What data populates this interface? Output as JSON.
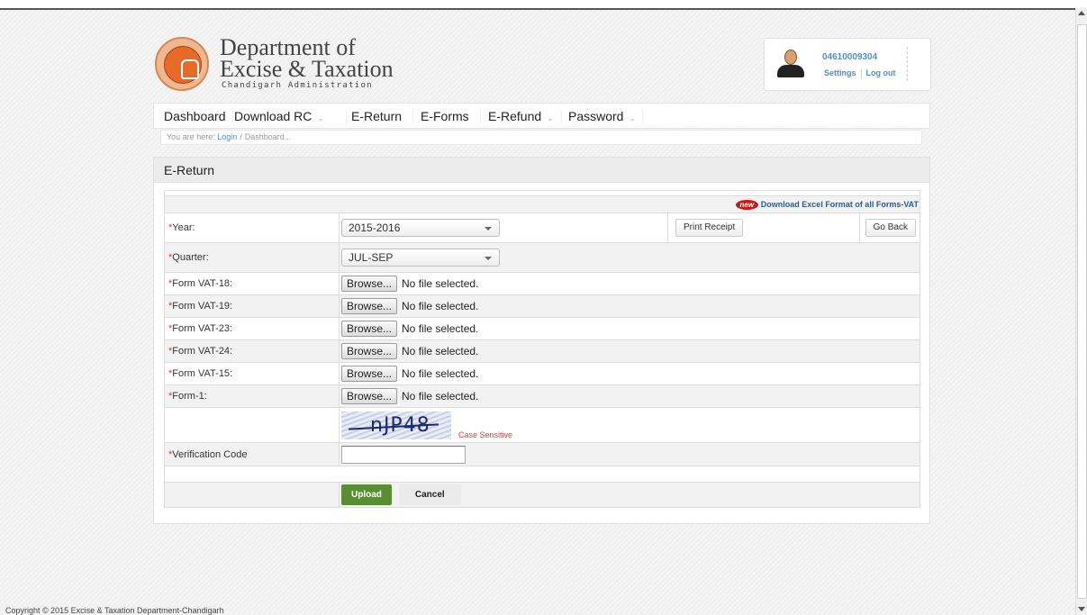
{
  "header": {
    "title_line1": "Department of",
    "title_line2": "Excise & Taxation",
    "subtitle": "Chandigarh Administration"
  },
  "user": {
    "id": "04610009304",
    "settings_label": "Settings",
    "logout_label": "Log out"
  },
  "nav": {
    "dashboard": "Dashboard",
    "download_rc": "Download RC",
    "e_return": "E-Return",
    "e_forms": "E-Forms",
    "e_refund": "E-Refund",
    "password": "Password"
  },
  "breadcrumb": {
    "prefix": "You are here:",
    "login": "Login",
    "separator": "/",
    "current": "Dashboard..."
  },
  "panel": {
    "title": "E-Return"
  },
  "form": {
    "download_link": "Download Excel Format of all Forms-VAT",
    "new_badge": "new",
    "required_mark": "*",
    "year_label": "Year:",
    "year_value": "2015-2016",
    "quarter_label": "Quarter:",
    "quarter_value": "JUL-SEP",
    "print_receipt": "Print Receipt",
    "go_back": "Go Back",
    "browse_label": "Browse...",
    "no_file": "No file selected.",
    "file_fields": [
      "Form VAT-18:",
      "Form VAT-19:",
      "Form VAT-23:",
      "Form VAT-24:",
      "Form VAT-15:",
      "Form-1:"
    ],
    "captcha_text": "nJP48",
    "case_sensitive": "Case Sensitive",
    "verification_label": "Verification Code",
    "verification_value": "",
    "upload_label": "Upload",
    "cancel_label": "Cancel"
  },
  "footer": {
    "text": "Copyright © 2015 Excise & Taxation Department-Chandigarh"
  },
  "colors": {
    "link": "#4f8fc7",
    "required": "#e33333",
    "upload_button": "#5a8e35",
    "new_badge": "#c81a1a"
  }
}
